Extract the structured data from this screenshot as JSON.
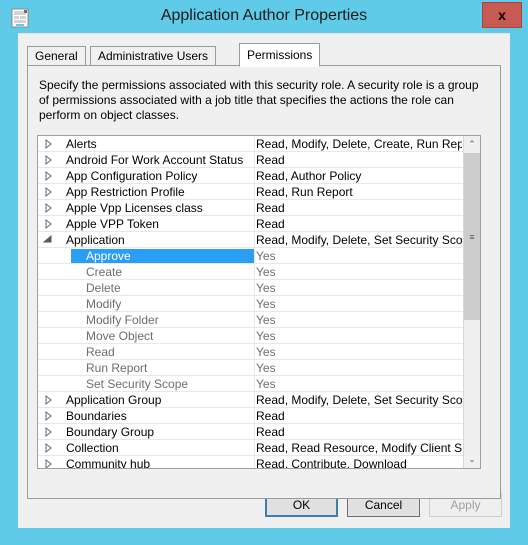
{
  "window": {
    "title": "Application Author Properties",
    "icon": "properties-document-icon",
    "close_label": "x",
    "accent_color": "#5fcbe8",
    "close_color": "#c75b54"
  },
  "tabs": [
    {
      "label": "General",
      "active": false
    },
    {
      "label": "Administrative Users",
      "active": false
    },
    {
      "label": "Permissions",
      "active": true
    }
  ],
  "description": "Specify the permissions associated with this security role. A security role is a group of permissions associated with a job title that specifies the actions the role can perform on object classes.",
  "list": {
    "selection_color": "#2a9ef4",
    "rows": [
      {
        "type": "parent",
        "state": "collapsed",
        "label": "Alerts",
        "value": "Read, Modify, Delete, Create, Run Report, M"
      },
      {
        "type": "parent",
        "state": "collapsed",
        "label": "Android For Work Account Status",
        "value": "Read"
      },
      {
        "type": "parent",
        "state": "collapsed",
        "label": "App Configuration Policy",
        "value": "Read, Author Policy"
      },
      {
        "type": "parent",
        "state": "collapsed",
        "label": "App Restriction Profile",
        "value": "Read, Run Report"
      },
      {
        "type": "parent",
        "state": "collapsed",
        "label": "Apple Vpp Licenses class",
        "value": "Read"
      },
      {
        "type": "parent",
        "state": "collapsed",
        "label": "Apple VPP Token",
        "value": "Read"
      },
      {
        "type": "parent",
        "state": "expanded",
        "label": "Application",
        "value": "Read, Modify, Delete, Set Security Scope, Cr"
      },
      {
        "type": "child",
        "state": "none",
        "label": "Approve",
        "value": "Yes",
        "selected": true
      },
      {
        "type": "child",
        "state": "none",
        "label": "Create",
        "value": "Yes"
      },
      {
        "type": "child",
        "state": "none",
        "label": "Delete",
        "value": "Yes"
      },
      {
        "type": "child",
        "state": "none",
        "label": "Modify",
        "value": "Yes"
      },
      {
        "type": "child",
        "state": "none",
        "label": "Modify Folder",
        "value": "Yes"
      },
      {
        "type": "child",
        "state": "none",
        "label": "Move Object",
        "value": "Yes"
      },
      {
        "type": "child",
        "state": "none",
        "label": "Read",
        "value": "Yes"
      },
      {
        "type": "child",
        "state": "none",
        "label": "Run Report",
        "value": "Yes"
      },
      {
        "type": "child",
        "state": "none",
        "label": "Set Security Scope",
        "value": "Yes"
      },
      {
        "type": "parent",
        "state": "collapsed",
        "label": "Application Group",
        "value": "Read, Modify, Delete, Set Security Scope, Cr"
      },
      {
        "type": "parent",
        "state": "collapsed",
        "label": "Boundaries",
        "value": "Read"
      },
      {
        "type": "parent",
        "state": "collapsed",
        "label": "Boundary Group",
        "value": "Read"
      },
      {
        "type": "parent",
        "state": "collapsed",
        "label": "Collection",
        "value": "Read, Read Resource, Modify Client Status A"
      },
      {
        "type": "parent",
        "state": "collapsed",
        "label": "Community hub",
        "value": "Read, Contribute, Download"
      }
    ],
    "scrollbar": {
      "up_glyph": "⌃",
      "down_glyph": "⌄",
      "grip_glyph": "≡"
    }
  },
  "buttons": {
    "ok": "OK",
    "cancel": "Cancel",
    "apply": "Apply"
  }
}
